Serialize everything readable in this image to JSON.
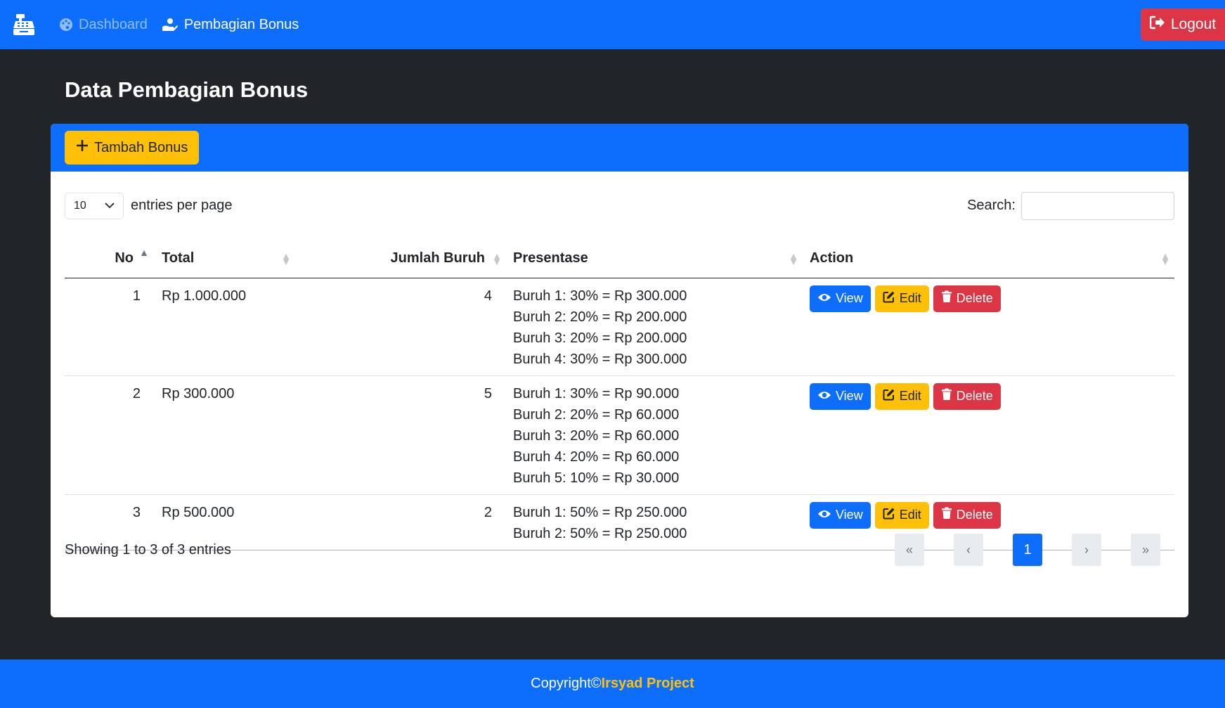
{
  "nav": {
    "brand_icon": "cash-register-icon",
    "items": [
      {
        "label": "Dashboard",
        "icon": "palette-icon"
      },
      {
        "label": "Pembagian Bonus",
        "icon": "hand-holding-dollar-icon"
      }
    ],
    "logout_label": "Logout"
  },
  "page": {
    "title": "Data Pembagian Bonus"
  },
  "card": {
    "add_button_label": "Tambah Bonus",
    "entries_value": "10",
    "entries_label": "entries per page",
    "search_label": "Search:",
    "search_value": "",
    "columns": [
      "No",
      "Total",
      "Jumlah Buruh",
      "Presentase",
      "Action"
    ],
    "rows": [
      {
        "no": "1",
        "total": "Rp 1.000.000",
        "jumlah": "4",
        "presentase": [
          "Buruh 1: 30% = Rp 300.000",
          "Buruh 2: 20% = Rp 200.000",
          "Buruh 3: 20% = Rp 200.000",
          "Buruh 4: 30% = Rp 300.000"
        ]
      },
      {
        "no": "2",
        "total": "Rp 300.000",
        "jumlah": "5",
        "presentase": [
          "Buruh 1: 30% = Rp 90.000",
          "Buruh 2: 20% = Rp 60.000",
          "Buruh 3: 20% = Rp 60.000",
          "Buruh 4: 20% = Rp 60.000",
          "Buruh 5: 10% = Rp 30.000"
        ]
      },
      {
        "no": "3",
        "total": "Rp 500.000",
        "jumlah": "2",
        "presentase": [
          "Buruh 1: 50% = Rp 250.000",
          "Buruh 2: 50% = Rp 250.000"
        ]
      }
    ],
    "action_labels": {
      "view": "View",
      "edit": "Edit",
      "delete": "Delete"
    },
    "info_text": "Showing 1 to 3 of 3 entries",
    "pagination": {
      "first": "«",
      "prev": "‹",
      "current": "1",
      "next": "›",
      "last": "»"
    }
  },
  "footer": {
    "prefix": "Copyright©",
    "brand": "Irsyad Project"
  },
  "colors": {
    "primary": "#0d6efd",
    "warning": "#ffc107",
    "danger": "#dc3545",
    "dark": "#212529"
  }
}
